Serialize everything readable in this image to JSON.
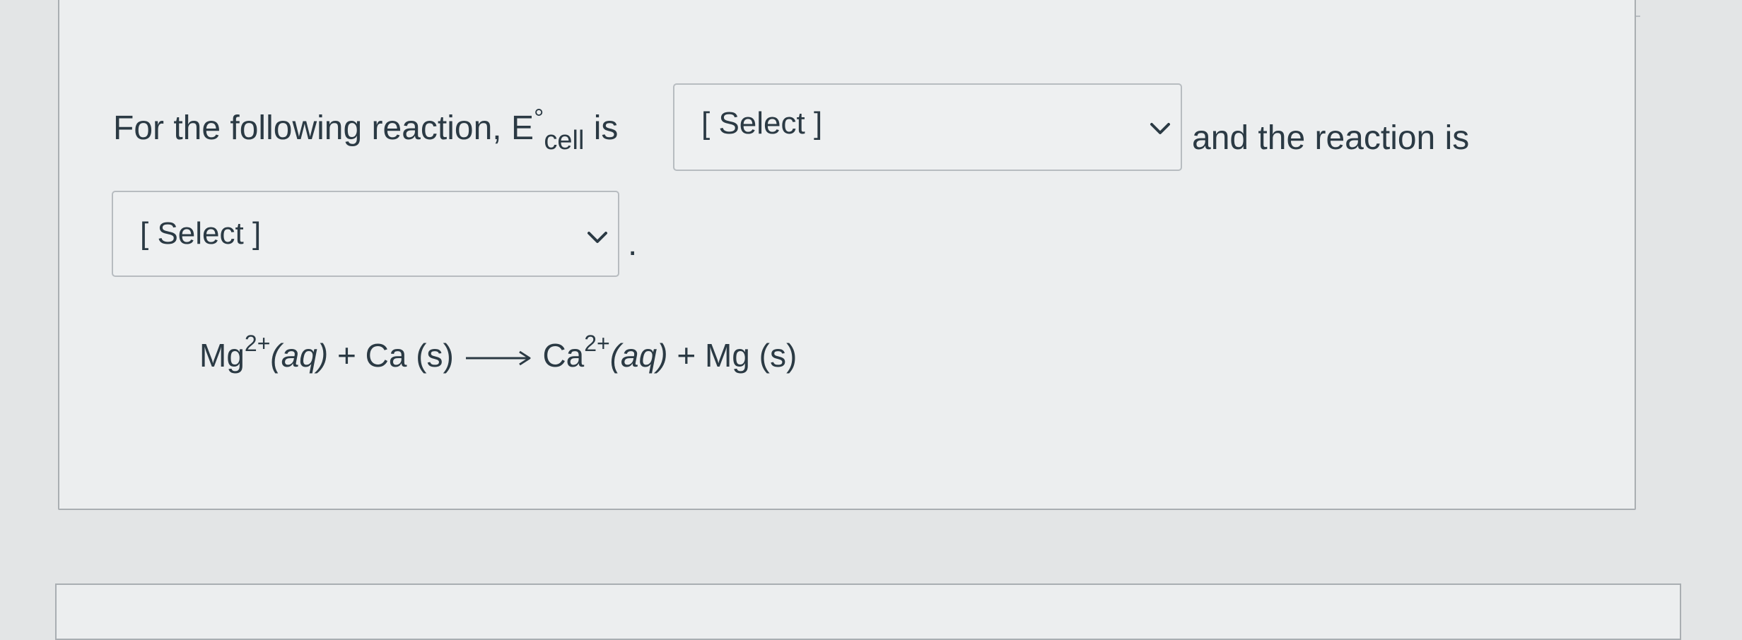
{
  "question": {
    "prefix": "For the following reaction, E",
    "degree": "°",
    "subscript": "cell",
    "is_text": "is",
    "after_select": "and the reaction is",
    "period": "."
  },
  "select1": {
    "label": "[ Select ]"
  },
  "select2": {
    "label": "[ Select ]"
  },
  "equation": {
    "mg": "Mg",
    "mg_charge": "2+",
    "aq1": "(aq)",
    "plus1": " + ",
    "ca_s": "Ca (s)",
    "ca": "Ca",
    "ca_charge": "2+",
    "aq2": "(aq)",
    "plus2": " + ",
    "mg_s": "Mg (s)"
  },
  "icons": {
    "chevron": "chevron-down-icon",
    "arrow": "reaction-arrow-icon"
  }
}
